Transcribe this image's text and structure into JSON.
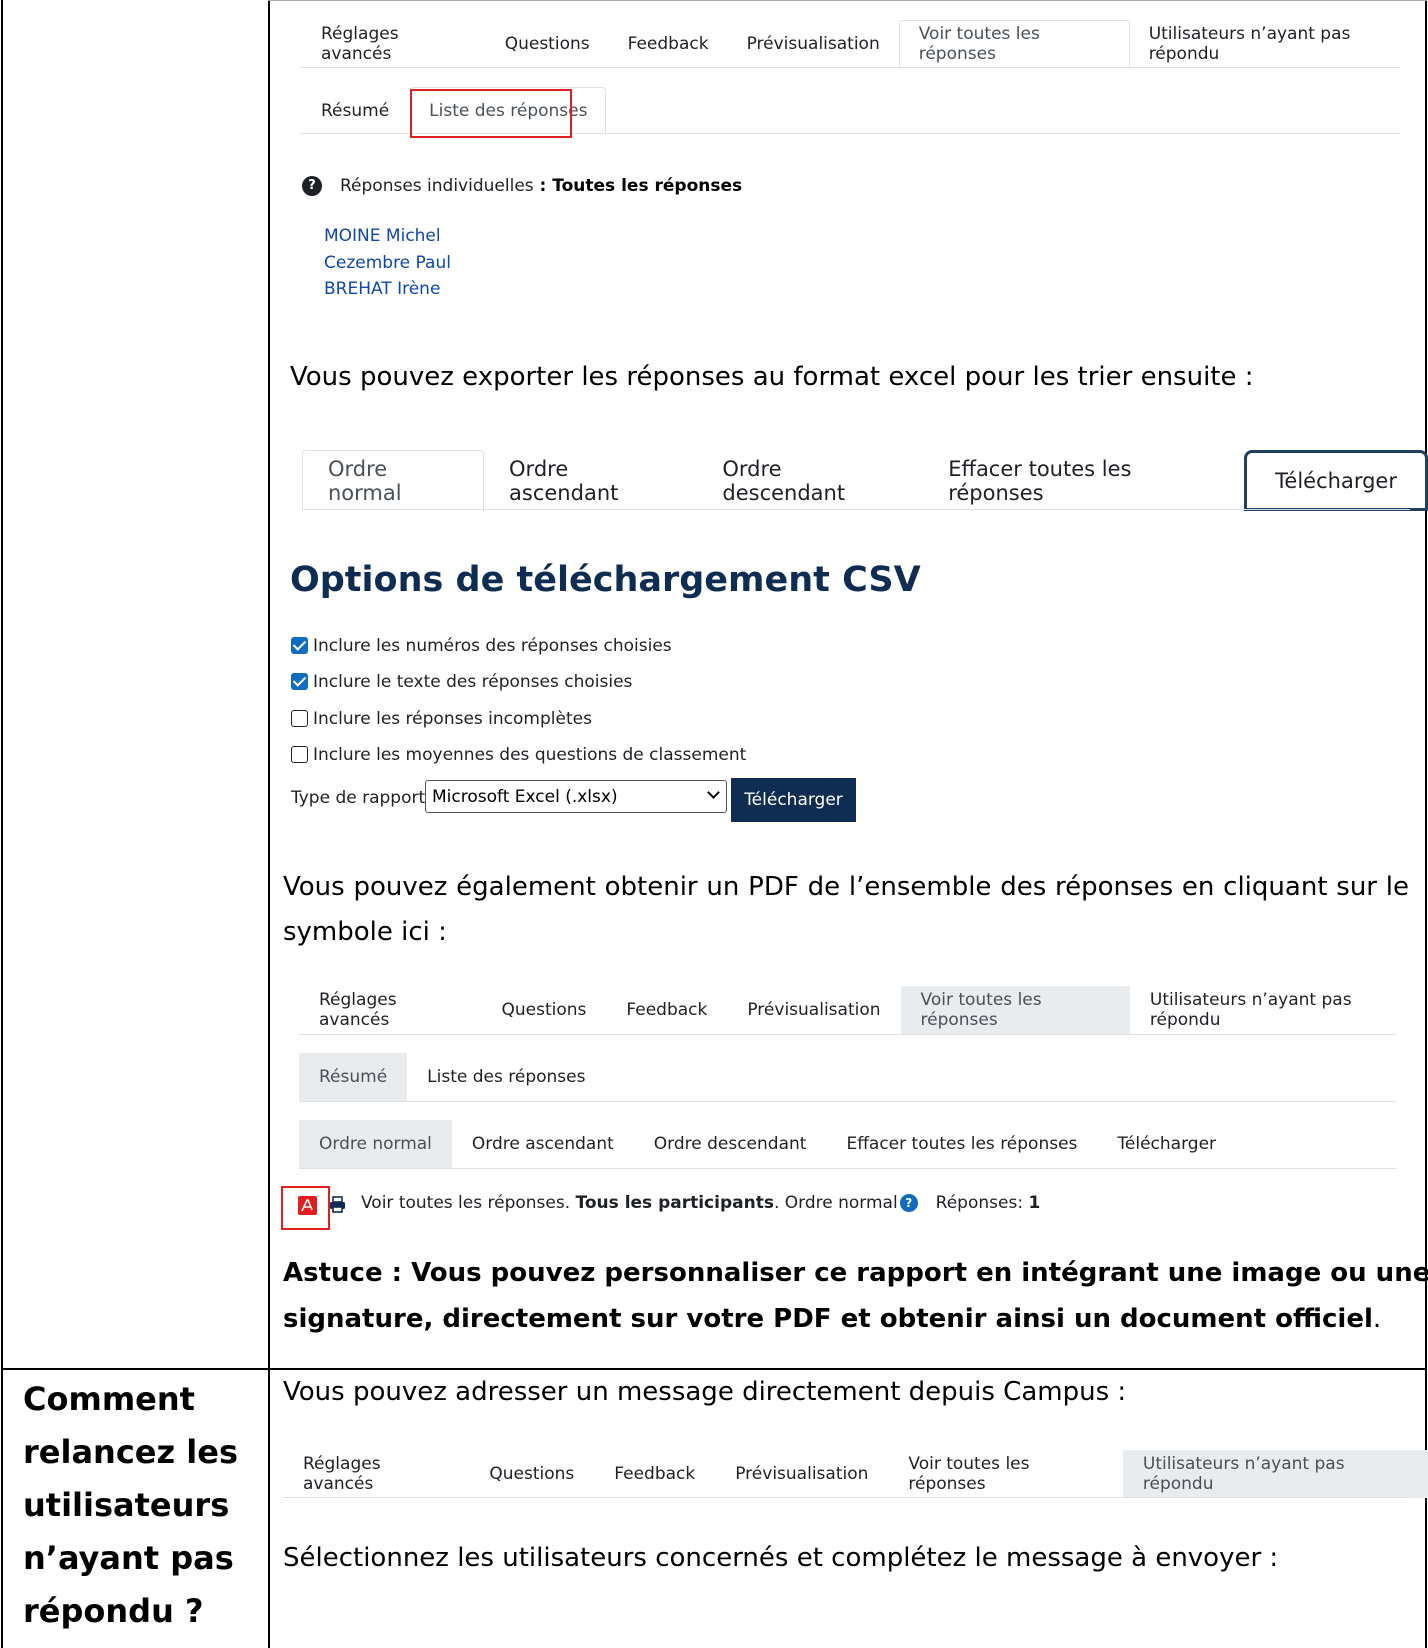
{
  "colors": {
    "link": "#0f47ad",
    "heading": "#0f2d52",
    "highlight": "#e02020",
    "tab_grey": "#e9ecef"
  },
  "tabs_top": {
    "items": [
      "Réglages avancés",
      "Questions",
      "Feedback",
      "Prévisualisation",
      "Voir toutes les réponses",
      "Utilisateurs n’ayant pas répondu"
    ],
    "active": "Voir toutes les réponses"
  },
  "subtabs_top": {
    "items": [
      "Résumé",
      "Liste des réponses"
    ],
    "active": "Liste des réponses"
  },
  "individual": {
    "label": "Réponses individuelles",
    "separator": " : ",
    "value": "Toutes les réponses"
  },
  "respondents": [
    "MOINE Michel",
    "Cezembre Paul",
    "BREHAT Irène"
  ],
  "export_text": "Vous pouvez exporter les réponses au format excel pour les trier ensuite :",
  "order_tabs": {
    "items": [
      "Ordre normal",
      "Ordre ascendant",
      "Ordre descendant",
      "Effacer toutes les réponses",
      "Télécharger"
    ],
    "active": "Ordre normal",
    "highlighted": "Télécharger"
  },
  "csv": {
    "heading": "Options de téléchargement CSV",
    "options": [
      {
        "label": "Inclure les numéros des réponses choisies",
        "checked": true
      },
      {
        "label": "Inclure le texte des réponses choisies",
        "checked": true
      },
      {
        "label": "Inclure les réponses incomplètes",
        "checked": false
      },
      {
        "label": "Inclure les moyennes des questions de classement",
        "checked": false
      }
    ],
    "report_type_label": "Type de rapport",
    "report_type_value": "Microsoft Excel (.xlsx)",
    "download_button": "Télécharger"
  },
  "pdf_text": {
    "line1": "Vous pouvez également obtenir un PDF de l’ensemble des réponses en cliquant sur le",
    "line2": "symbole ici :"
  },
  "tabs_mid": {
    "items": [
      "Réglages avancés",
      "Questions",
      "Feedback",
      "Prévisualisation",
      "Voir toutes les réponses",
      "Utilisateurs n’ayant pas répondu"
    ],
    "active": "Voir toutes les réponses"
  },
  "subtabs_mid": {
    "items": [
      "Résumé",
      "Liste des réponses"
    ],
    "active": "Résumé"
  },
  "order_tabs_mid": {
    "items": [
      "Ordre normal",
      "Ordre ascendant",
      "Ordre descendant",
      "Effacer toutes les réponses",
      "Télécharger"
    ],
    "active": "Ordre normal"
  },
  "view_line": {
    "prefix": "Voir toutes les réponses. ",
    "bold": "Tous les participants",
    "suffix": ". Ordre normal",
    "responses_label": "Réponses: ",
    "responses_count": "1"
  },
  "tip": {
    "line1": "Astuce : Vous pouvez personnaliser ce rapport en intégrant une image ou une",
    "line2_bold": "signature, directement sur votre PDF et obtenir ainsi un document officiel",
    "line2_end": "."
  },
  "question_cell": {
    "lines": [
      "Comment",
      "relancez les",
      "utilisateurs",
      "n’ayant pas",
      "répondu ?"
    ]
  },
  "message_text": "Vous pouvez adresser un message directement depuis Campus :",
  "tabs_bottom": {
    "items": [
      "Réglages avancés",
      "Questions",
      "Feedback",
      "Prévisualisation",
      "Voir toutes les réponses",
      "Utilisateurs n’ayant pas répondu"
    ],
    "active": "Utilisateurs n’ayant pas répondu"
  },
  "select_users_text": "Sélectionnez les utilisateurs concernés et complétez le message à envoyer :"
}
